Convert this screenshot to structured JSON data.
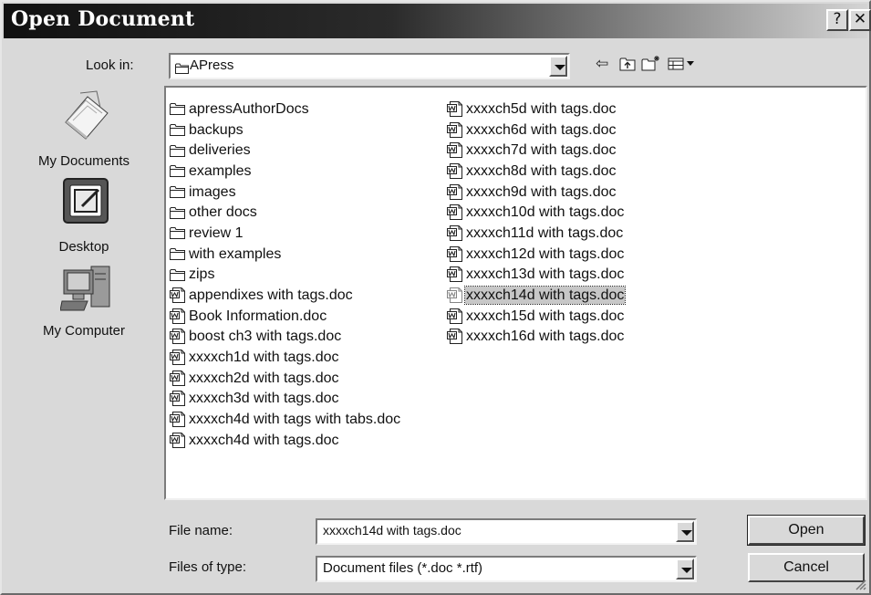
{
  "window": {
    "title": "Open Document",
    "help_glyph": "?",
    "close_glyph": "✕"
  },
  "lookin": {
    "label": "Look in:",
    "value": "APress"
  },
  "places": [
    {
      "label": "My Documents",
      "icon": "my-documents-icon"
    },
    {
      "label": "Desktop",
      "icon": "desktop-icon"
    },
    {
      "label": "My Computer",
      "icon": "my-computer-icon"
    }
  ],
  "files": {
    "col1": [
      {
        "name": "apressAuthorDocs",
        "type": "folder"
      },
      {
        "name": "backups",
        "type": "folder"
      },
      {
        "name": "deliveries",
        "type": "folder"
      },
      {
        "name": "examples",
        "type": "folder"
      },
      {
        "name": "images",
        "type": "folder"
      },
      {
        "name": "other docs",
        "type": "folder"
      },
      {
        "name": "review 1",
        "type": "folder"
      },
      {
        "name": "with examples",
        "type": "folder"
      },
      {
        "name": "zips",
        "type": "folder"
      },
      {
        "name": "appendixes with tags.doc",
        "type": "doc"
      },
      {
        "name": "Book Information.doc",
        "type": "doc"
      },
      {
        "name": "boost ch3 with tags.doc",
        "type": "doc"
      },
      {
        "name": "xxxxch1d with tags.doc",
        "type": "doc"
      },
      {
        "name": "xxxxch2d with tags.doc",
        "type": "doc"
      },
      {
        "name": "xxxxch3d with tags.doc",
        "type": "doc"
      },
      {
        "name": "xxxxch4d with tags with tabs.doc",
        "type": "doc"
      },
      {
        "name": "xxxxch4d with tags.doc",
        "type": "doc"
      }
    ],
    "col2": [
      {
        "name": "xxxxch5d with tags.doc",
        "type": "doc"
      },
      {
        "name": "xxxxch6d with tags.doc",
        "type": "doc"
      },
      {
        "name": "xxxxch7d with tags.doc",
        "type": "doc"
      },
      {
        "name": "xxxxch8d with tags.doc",
        "type": "doc"
      },
      {
        "name": "xxxxch9d with tags.doc",
        "type": "doc"
      },
      {
        "name": "xxxxch10d with tags.doc",
        "type": "doc"
      },
      {
        "name": "xxxxch11d with tags.doc",
        "type": "doc"
      },
      {
        "name": "xxxxch12d with tags.doc",
        "type": "doc"
      },
      {
        "name": "xxxxch13d with tags.doc",
        "type": "doc"
      },
      {
        "name": "xxxxch14d with tags.doc",
        "type": "doc",
        "selected": true
      },
      {
        "name": "xxxxch15d with tags.doc",
        "type": "doc"
      },
      {
        "name": "xxxxch16d with tags.doc",
        "type": "doc"
      }
    ]
  },
  "filename": {
    "label": "File name:",
    "value": "xxxxch14d with tags.doc"
  },
  "filetype": {
    "label": "Files of type:",
    "value": "Document files (*.doc *.rtf)"
  },
  "buttons": {
    "open": "Open",
    "cancel": "Cancel"
  }
}
